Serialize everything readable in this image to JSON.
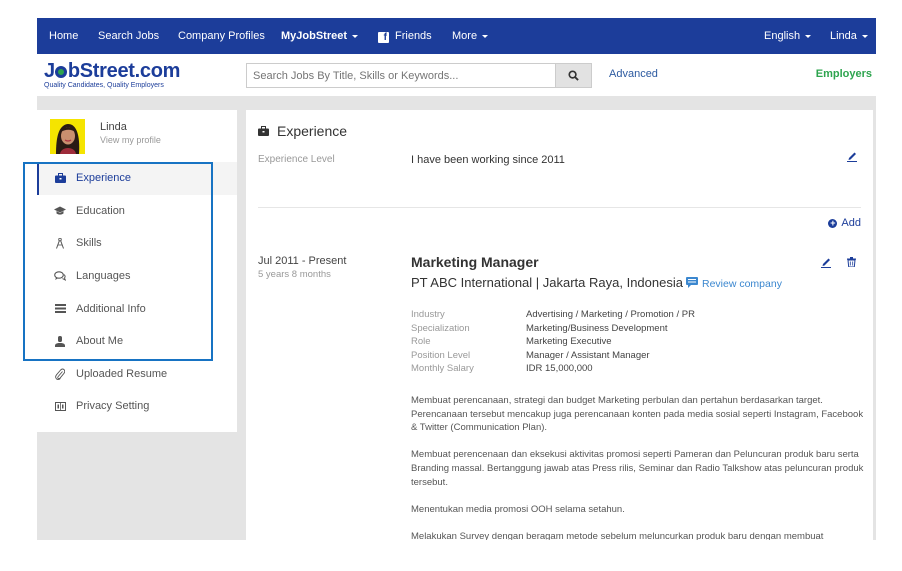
{
  "nav": {
    "items": [
      {
        "label": "Home"
      },
      {
        "label": "Search Jobs"
      },
      {
        "label": "Company Profiles"
      },
      {
        "label": "MyJobStreet"
      },
      {
        "label": "Friends"
      },
      {
        "label": "More"
      }
    ],
    "language": "English",
    "user": "Linda"
  },
  "header": {
    "logo_text_pre": "J",
    "logo_text_post": "bStreet.com",
    "logo_tagline": "Quality Candidates, Quality Employers",
    "search_placeholder": "Search Jobs By Title, Skills or Keywords...",
    "advanced_label": "Advanced",
    "employers_label": "Employers"
  },
  "colors": {
    "nav_bg": "#1c3d9a",
    "accent": "#1c3d9a",
    "employers_green": "#2da44e",
    "highlight_box": "#1773c3",
    "link_blue": "#3b87cf"
  },
  "sidebar": {
    "profile_name": "Linda",
    "profile_link": "View my profile",
    "items": [
      {
        "label": "Experience",
        "icon": "briefcase-icon",
        "active": true
      },
      {
        "label": "Education",
        "icon": "graduation-cap-icon"
      },
      {
        "label": "Skills",
        "icon": "compass-icon"
      },
      {
        "label": "Languages",
        "icon": "chat-bubbles-icon"
      },
      {
        "label": "Additional Info",
        "icon": "list-icon"
      },
      {
        "label": "About Me",
        "icon": "user-icon"
      },
      {
        "label": "Uploaded Resume",
        "icon": "paperclip-icon"
      },
      {
        "label": "Privacy Setting",
        "icon": "privacy-icon"
      }
    ]
  },
  "main": {
    "section_title": "Experience",
    "experience_level_label": "Experience Level",
    "experience_level_value": "I have been working since 2011",
    "add_label": "Add",
    "job": {
      "dates": "Jul 2011 - Present",
      "duration": "5 years 8 months",
      "title": "Marketing Manager",
      "company": "PT ABC International | Jakarta Raya, Indonesia",
      "review_label": "Review company",
      "details": [
        {
          "label": "Industry",
          "value": "Advertising / Marketing / Promotion / PR"
        },
        {
          "label": "Specialization",
          "value": "Marketing/Business Development"
        },
        {
          "label": "Role",
          "value": "Marketing Executive"
        },
        {
          "label": "Position Level",
          "value": "Manager / Assistant Manager"
        },
        {
          "label": "Monthly Salary",
          "value": "IDR 15,000,000"
        }
      ],
      "description": [
        "Membuat perencanaan, strategi dan budget Marketing perbulan dan pertahun berdasarkan   target. Perencanaan tersebut mencakup juga perencanaan konten pada media sosial seperti Instagram, Facebook & Twitter (Communication Plan).",
        "Membuat perencenaan dan eksekusi aktivitas promosi seperti Pameran dan Peluncuran produk baru serta Branding massal. Bertanggung jawab atas Press rilis, Seminar dan Radio Talkshow atas peluncuran produk tersebut.",
        "Menentukan media promosi OOH selama setahun.",
        "Melakukan Survey dengan beragam metode sebelum meluncurkan produk baru dengan membuat"
      ]
    }
  }
}
